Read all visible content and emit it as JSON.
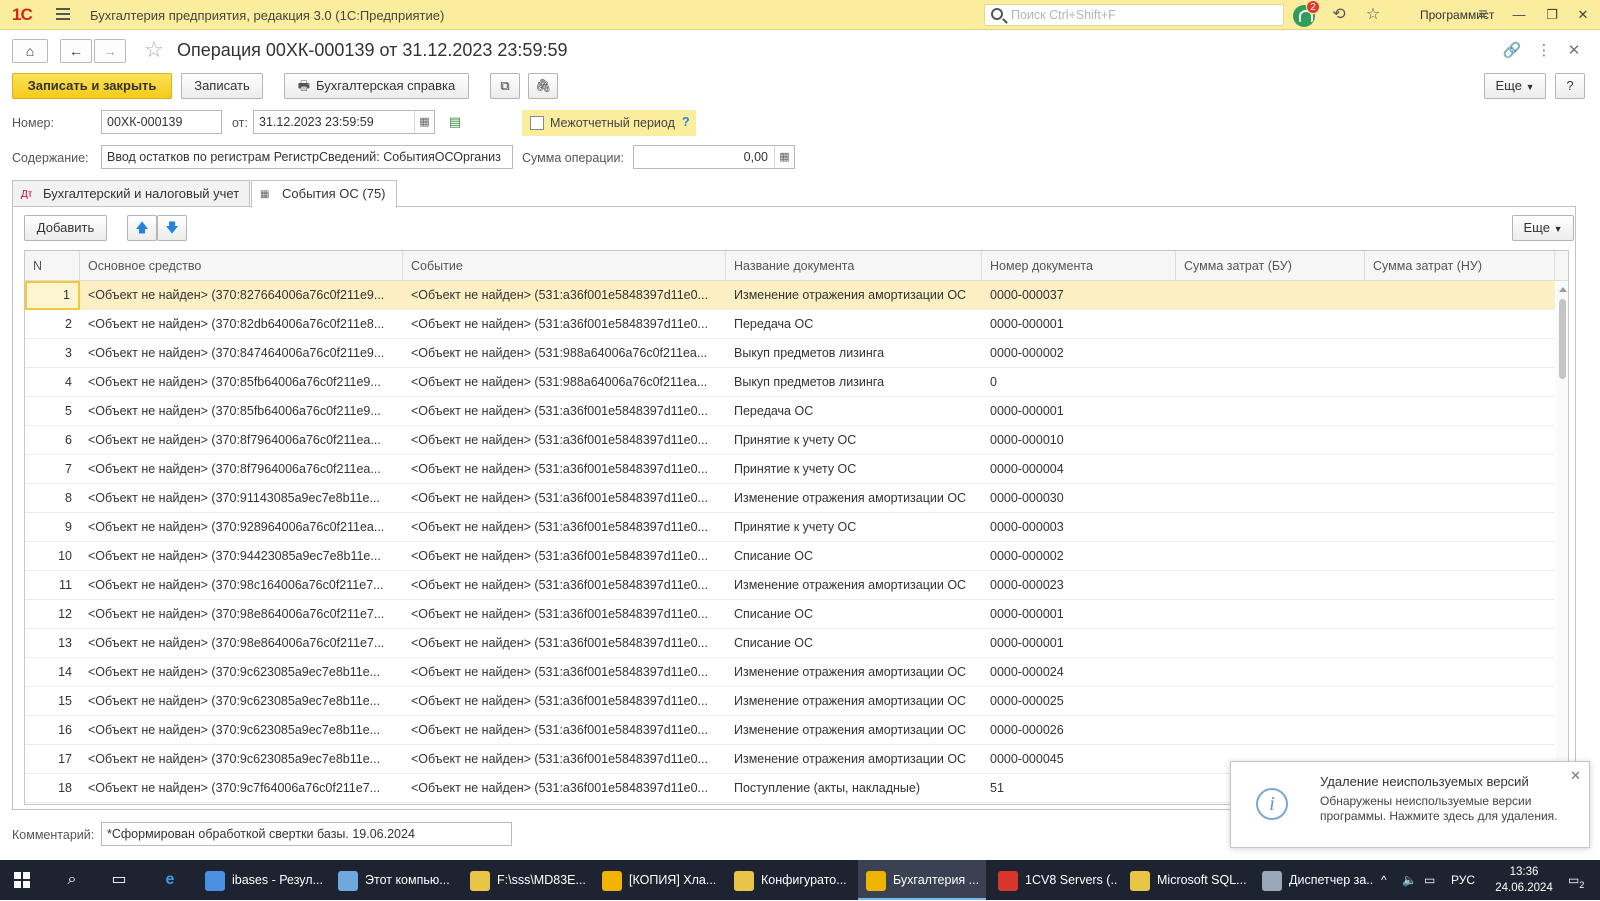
{
  "app": {
    "title": "Бухгалтерия предприятия, редакция 3.0 (1С:Предприятие)",
    "logo": "1С",
    "search_placeholder": "Поиск Ctrl+Shift+F",
    "notifications_count": "2",
    "user": "Программист"
  },
  "document": {
    "title": "Операция 00ХК-000139 от 31.12.2023 23:59:59"
  },
  "toolbar": {
    "save_close": "Записать и закрыть",
    "save": "Записать",
    "report": "Бухгалтерская справка",
    "more": "Еще",
    "help": "?"
  },
  "form": {
    "number_label": "Номер:",
    "number_value": "00ХК-000139",
    "date_label": "от:",
    "date_value": "31.12.2023 23:59:59",
    "period_label": "Межотчетный период",
    "period_help": "?",
    "content_label": "Содержание:",
    "content_value": "Ввод остатков по регистрам РегистрСведений: СобытияОСОрганиз",
    "sum_label": "Сумма операции:",
    "sum_value": "0,00",
    "comment_label": "Комментарий:",
    "comment_value": "*Сформирован обработкой свертки базы. 19.06.2024"
  },
  "tabs": [
    {
      "label": "Бухгалтерский и налоговый учет"
    },
    {
      "label": "События ОС (75)"
    }
  ],
  "table_toolbar": {
    "add": "Добавить",
    "more": "Еще"
  },
  "table": {
    "columns": [
      "N",
      "Основное средство",
      "Событие",
      "Название документа",
      "Номер документа",
      "Сумма затрат (БУ)",
      "Сумма затрат (НУ)"
    ],
    "rows": [
      [
        "1",
        "<Объект не найден> (370:827664006a76c0f211e9...",
        "<Объект не найден> (531:a36f001e5848397d11e0...",
        "Изменение отражения амортизации ОС",
        "0000-000037",
        "",
        ""
      ],
      [
        "2",
        "<Объект не найден> (370:82db64006a76c0f211e8...",
        "<Объект не найден> (531:a36f001e5848397d11e0...",
        "Передача ОС",
        "0000-000001",
        "",
        ""
      ],
      [
        "3",
        "<Объект не найден> (370:847464006a76c0f211e9...",
        "<Объект не найден> (531:988a64006a76c0f211ea...",
        "Выкуп предметов лизинга",
        "0000-000002",
        "",
        ""
      ],
      [
        "4",
        "<Объект не найден> (370:85fb64006a76c0f211e9...",
        "<Объект не найден> (531:988a64006a76c0f211ea...",
        "Выкуп предметов лизинга",
        "0",
        "",
        ""
      ],
      [
        "5",
        "<Объект не найден> (370:85fb64006a76c0f211e9...",
        "<Объект не найден> (531:a36f001e5848397d11e0...",
        "Передача ОС",
        "0000-000001",
        "",
        ""
      ],
      [
        "6",
        "<Объект не найден> (370:8f7964006a76c0f211ea...",
        "<Объект не найден> (531:a36f001e5848397d11e0...",
        "Принятие к учету ОС",
        "0000-000010",
        "",
        ""
      ],
      [
        "7",
        "<Объект не найден> (370:8f7964006a76c0f211ea...",
        "<Объект не найден> (531:a36f001e5848397d11e0...",
        "Принятие к учету ОС",
        "0000-000004",
        "",
        ""
      ],
      [
        "8",
        "<Объект не найден> (370:91143085a9ec7e8b11e...",
        "<Объект не найден> (531:a36f001e5848397d11e0...",
        "Изменение отражения амортизации ОС",
        "0000-000030",
        "",
        ""
      ],
      [
        "9",
        "<Объект не найден> (370:928964006a76c0f211ea...",
        "<Объект не найден> (531:a36f001e5848397d11e0...",
        "Принятие к учету ОС",
        "0000-000003",
        "",
        ""
      ],
      [
        "10",
        "<Объект не найден> (370:94423085a9ec7e8b11e...",
        "<Объект не найден> (531:a36f001e5848397d11e0...",
        "Списание ОС",
        "0000-000002",
        "",
        ""
      ],
      [
        "11",
        "<Объект не найден> (370:98c164006a76c0f211e7...",
        "<Объект не найден> (531:a36f001e5848397d11e0...",
        "Изменение отражения амортизации ОС",
        "0000-000023",
        "",
        ""
      ],
      [
        "12",
        "<Объект не найден> (370:98e864006a76c0f211e7...",
        "<Объект не найден> (531:a36f001e5848397d11e0...",
        "Списание ОС",
        "0000-000001",
        "",
        ""
      ],
      [
        "13",
        "<Объект не найден> (370:98e864006a76c0f211e7...",
        "<Объект не найден> (531:a36f001e5848397d11e0...",
        "Списание ОС",
        "0000-000001",
        "",
        ""
      ],
      [
        "14",
        "<Объект не найден> (370:9c623085a9ec7e8b11e...",
        "<Объект не найден> (531:a36f001e5848397d11e0...",
        "Изменение отражения амортизации ОС",
        "0000-000024",
        "",
        ""
      ],
      [
        "15",
        "<Объект не найден> (370:9c623085a9ec7e8b11e...",
        "<Объект не найден> (531:a36f001e5848397d11e0...",
        "Изменение отражения амортизации ОС",
        "0000-000025",
        "",
        ""
      ],
      [
        "16",
        "<Объект не найден> (370:9c623085a9ec7e8b11e...",
        "<Объект не найден> (531:a36f001e5848397d11e0...",
        "Изменение отражения амортизации ОС",
        "0000-000026",
        "",
        ""
      ],
      [
        "17",
        "<Объект не найден> (370:9c623085a9ec7e8b11e...",
        "<Объект не найден> (531:a36f001e5848397d11e0...",
        "Изменение отражения амортизации ОС",
        "0000-000045",
        "",
        ""
      ],
      [
        "18",
        "<Объект не найден> (370:9c7f64006a76c0f211e7...",
        "<Объект не найден> (531:a36f001e5848397d11e0...",
        "Поступление (акты, накладные)",
        "51",
        "",
        ""
      ]
    ]
  },
  "notification": {
    "title": "Удаление неиспользуемых версий",
    "body": "Обнаружены неиспользуемые версии программы. Нажмите здесь для удаления."
  },
  "taskbar": {
    "items": [
      {
        "label": "ibases - Резул...",
        "color": "#4a90e2"
      },
      {
        "label": "Этот компью...",
        "color": "#6fa8dc"
      },
      {
        "label": "F:\\sss\\MD83E...",
        "color": "#e8c547"
      },
      {
        "label": "[КОПИЯ] Хла...",
        "color": "#f0b400"
      },
      {
        "label": "Конфигурато...",
        "color": "#e8c547"
      },
      {
        "label": "Бухгалтерия ...",
        "color": "#f0b400"
      },
      {
        "label": "1CV8 Servers (...",
        "color": "#d9352b"
      },
      {
        "label": "Microsoft SQL...",
        "color": "#e8c547"
      },
      {
        "label": "Диспетчер за...",
        "color": "#9aa7b8"
      }
    ],
    "lang": "РУС",
    "time": "13:36",
    "date": "24.06.2024",
    "tray_badge": "2"
  },
  "colors": {
    "accent": "#f5c918",
    "titlebar": "#fbed9e",
    "selected_row": "#fbefc3"
  }
}
